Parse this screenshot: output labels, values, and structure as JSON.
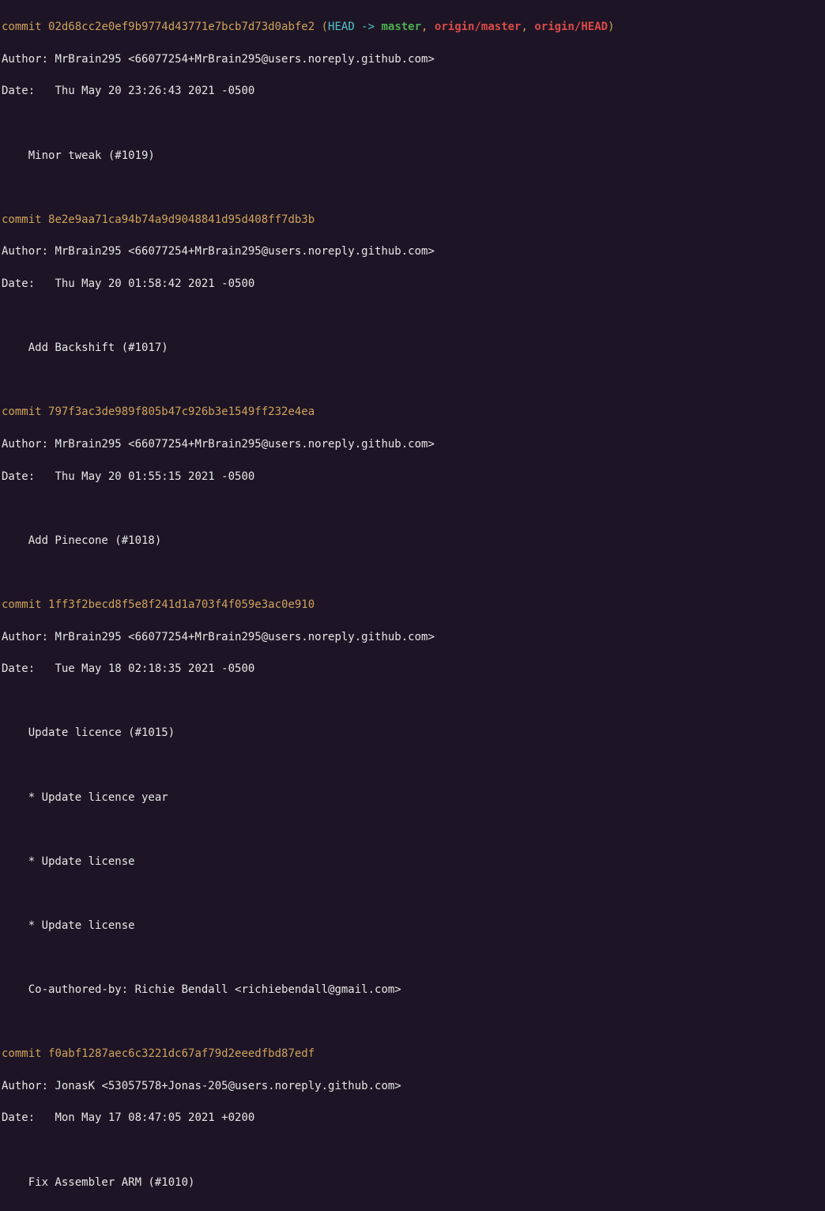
{
  "commits": [
    {
      "hash": "02d68cc2e0ef9b9774d43771e7bcb7d73d0abfe2",
      "refs": [
        "HEAD -> ",
        "master",
        ", ",
        "origin/master",
        ", ",
        "origin/HEAD"
      ],
      "author": "MrBrain295 <66077254+MrBrain295@users.noreply.github.com>",
      "date": "Thu May 20 23:26:43 2021 -0500",
      "body": [
        "Minor tweak (#1019)"
      ]
    },
    {
      "hash": "8e2e9aa71ca94b74a9d9048841d95d408ff7db3b",
      "refs": null,
      "author": "MrBrain295 <66077254+MrBrain295@users.noreply.github.com>",
      "date": "Thu May 20 01:58:42 2021 -0500",
      "body": [
        "Add Backshift (#1017)"
      ]
    },
    {
      "hash": "797f3ac3de989f805b47c926b3e1549ff232e4ea",
      "refs": null,
      "author": "MrBrain295 <66077254+MrBrain295@users.noreply.github.com>",
      "date": "Thu May 20 01:55:15 2021 -0500",
      "body": [
        "Add Pinecone (#1018)"
      ]
    },
    {
      "hash": "1ff3f2becd8f5e8f241d1a703f4f059e3ac0e910",
      "refs": null,
      "author": "MrBrain295 <66077254+MrBrain295@users.noreply.github.com>",
      "date": "Tue May 18 02:18:35 2021 -0500",
      "body": [
        "Update licence (#1015)",
        "",
        "* Update licence year",
        "",
        "* Update license",
        "",
        "* Update license",
        "",
        "Co-authored-by: Richie Bendall <richiebendall@gmail.com>"
      ]
    },
    {
      "hash": "f0abf1287aec6c3221dc67af79d2eeedfbd87edf",
      "refs": null,
      "author": "JonasK <53057578+Jonas-205@users.noreply.github.com>",
      "date": "Mon May 17 08:47:05 2021 +0200",
      "body": [
        "Fix Assembler ARM (#1010)"
      ]
    }
  ],
  "labels": {
    "commit": "commit ",
    "author": "Author: ",
    "date": "Date:   "
  }
}
